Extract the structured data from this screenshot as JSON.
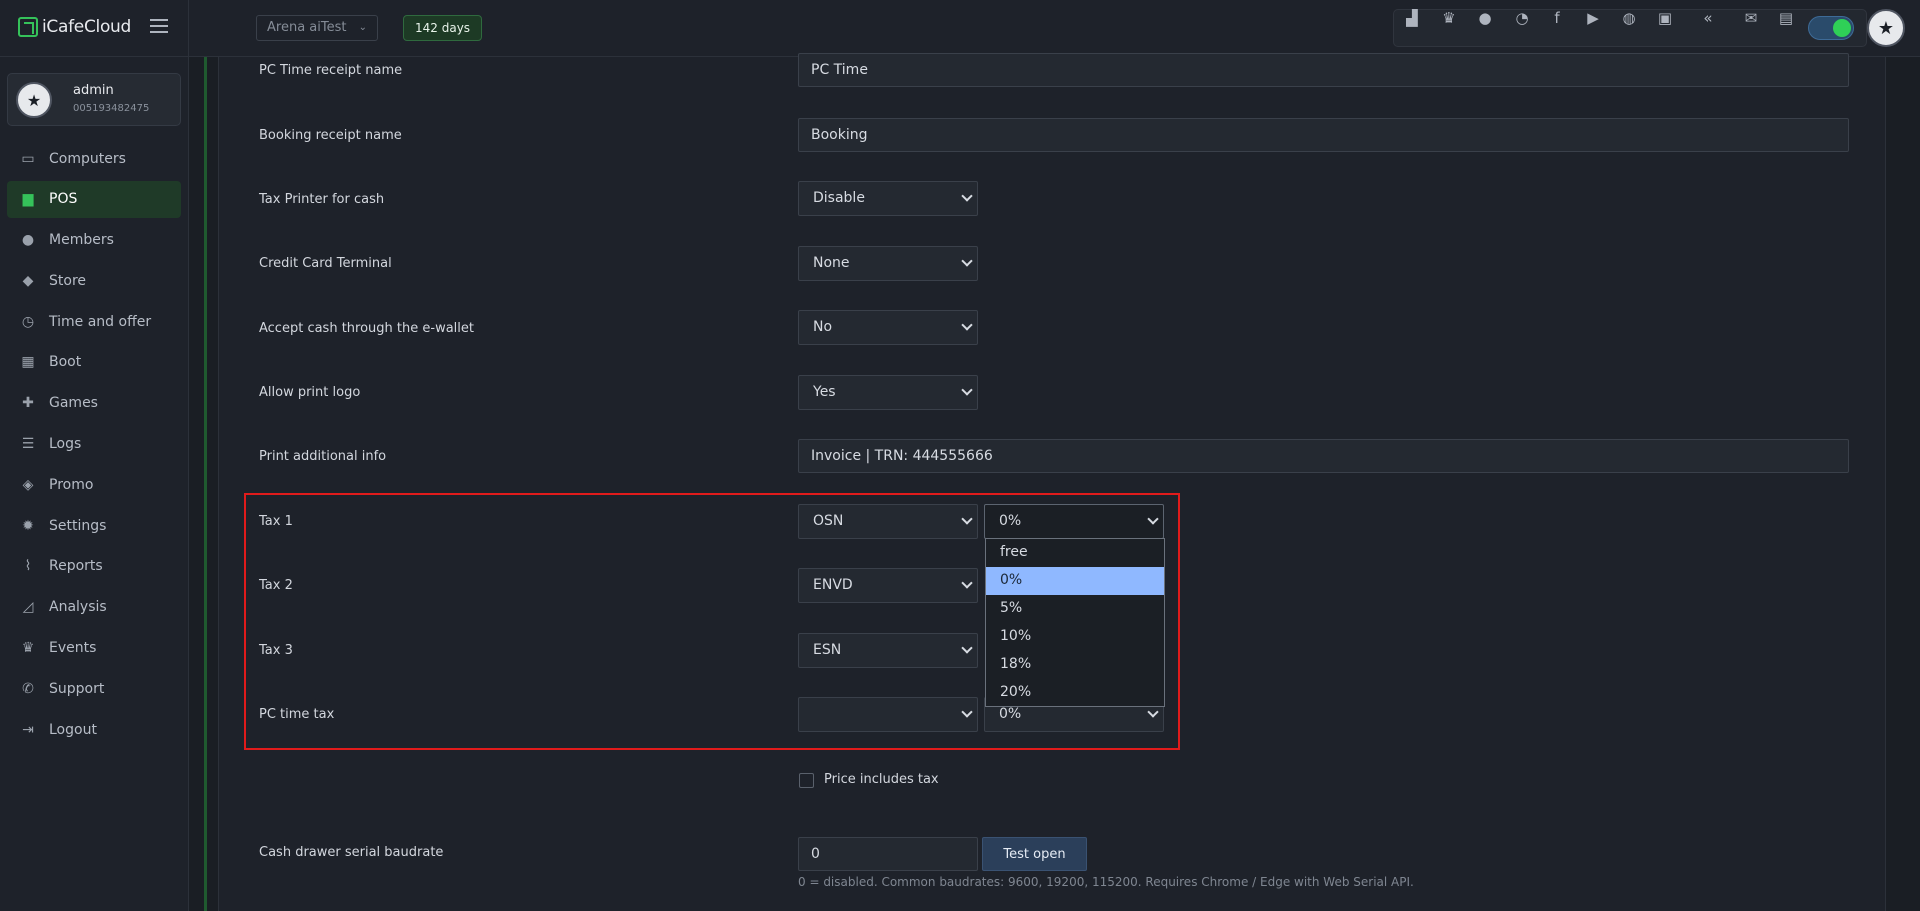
{
  "app": {
    "logo_text": "iCafeCloud",
    "center_name": "Arena aiTest",
    "days_badge": "142 days"
  },
  "top_icons": [
    "leaderboard-icon",
    "trophy-icon",
    "users-group-icon",
    "rss-icon",
    "facebook-icon",
    "youtube-icon",
    "globe-icon",
    "icafe-icon",
    "double-chevron-icon",
    "mail-icon",
    "chat-icon"
  ],
  "user": {
    "name": "admin",
    "id": "005193482475"
  },
  "sidebar": {
    "items": [
      {
        "label": "Computers",
        "icon": "monitor-icon"
      },
      {
        "label": "POS",
        "icon": "cash-register-icon"
      },
      {
        "label": "Members",
        "icon": "members-icon"
      },
      {
        "label": "Store",
        "icon": "shopping-bag-icon"
      },
      {
        "label": "Time and offer",
        "icon": "stopwatch-icon"
      },
      {
        "label": "Boot",
        "icon": "windows-icon"
      },
      {
        "label": "Games",
        "icon": "gamepad-icon"
      },
      {
        "label": "Logs",
        "icon": "list-icon"
      },
      {
        "label": "Promo",
        "icon": "tag-icon"
      },
      {
        "label": "Settings",
        "icon": "gear-icon"
      },
      {
        "label": "Reports",
        "icon": "line-chart-icon"
      },
      {
        "label": "Analysis",
        "icon": "area-chart-icon"
      },
      {
        "label": "Events",
        "icon": "crown-icon"
      },
      {
        "label": "Support",
        "icon": "phone-icon"
      },
      {
        "label": "Logout",
        "icon": "logout-icon"
      }
    ],
    "active": "POS"
  },
  "form": {
    "pc_time_receipt": {
      "label": "PC Time receipt name",
      "value": "PC Time"
    },
    "booking_receipt": {
      "label": "Booking receipt name",
      "value": "Booking"
    },
    "tax_printer": {
      "label": "Tax Printer for cash",
      "value": "Disable"
    },
    "credit_card": {
      "label": "Credit Card Terminal",
      "value": "None"
    },
    "accept_cash": {
      "label": "Accept cash through the e-wallet",
      "value": "No"
    },
    "print_logo": {
      "label": "Allow print logo",
      "value": "Yes"
    },
    "additional_info": {
      "label": "Print additional info",
      "value": "Invoice  |  TRN: 444555666"
    },
    "tax1": {
      "label": "Tax 1",
      "system": "OSN",
      "rate": "0%"
    },
    "tax2": {
      "label": "Tax 2",
      "system": "ENVD"
    },
    "tax3": {
      "label": "Tax 3",
      "system": "ESN"
    },
    "pc_time_tax": {
      "label": "PC time tax",
      "system": "",
      "rate": "0%"
    },
    "rate_options": [
      "free",
      "0%",
      "5%",
      "10%",
      "18%",
      "20%"
    ],
    "rate_selected": "0%",
    "price_includes_tax": {
      "label": "Price includes tax",
      "checked": false
    },
    "baudrate": {
      "label": "Cash drawer serial baudrate",
      "value": "0",
      "button": "Test open",
      "hint": "0 = disabled. Common baudrates: 9600, 19200, 115200. Requires Chrome / Edge with Web Serial API."
    }
  }
}
